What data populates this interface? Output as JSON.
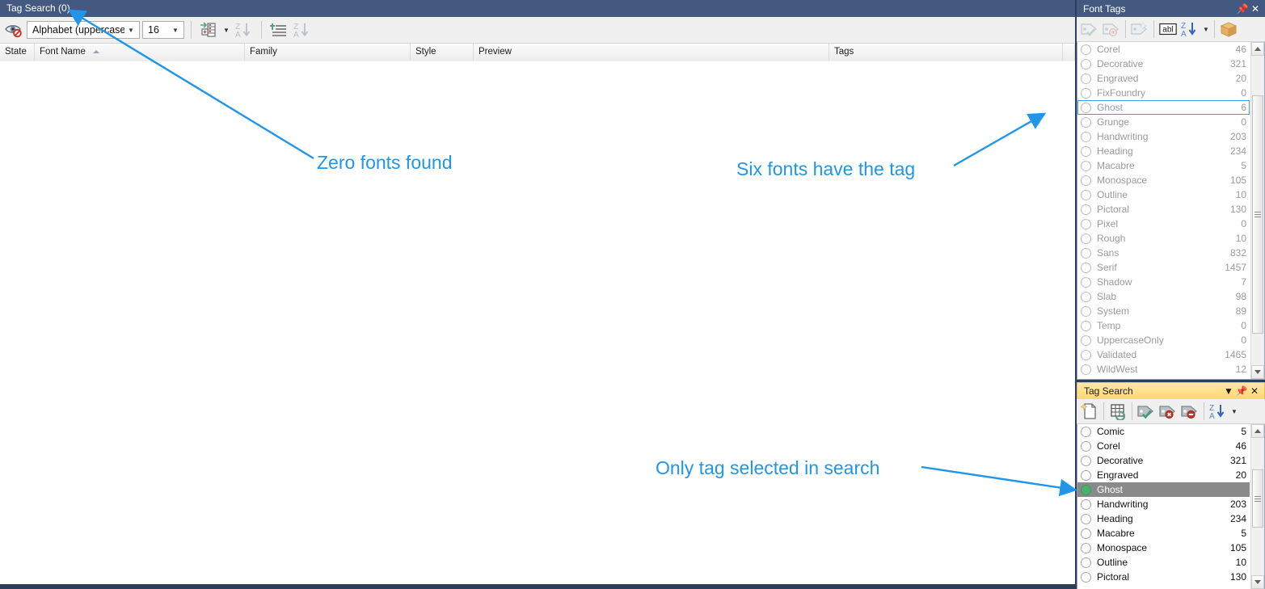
{
  "main_window": {
    "title": "Tag Search (0)",
    "toolbar": {
      "preview_icon": "eye-disabled-icon",
      "alphabet_combo": {
        "value": "Alphabet (uppercase)",
        "arrow": "chevron-down-icon"
      },
      "size_combo": {
        "value": "16",
        "arrow": "chevron-down-icon"
      },
      "group_button_icon": "add-to-collection-icon",
      "group_dropdown_icon": "chevron-down-icon",
      "sort_za_icon": "sort-za-descending-icon",
      "add_tag_icon": "add-tag-list-icon",
      "sort_za_icon_2": "sort-za-descending-icon"
    },
    "columns": [
      {
        "label": "State"
      },
      {
        "label": "Font Name",
        "sort": "ascending"
      },
      {
        "label": "Family"
      },
      {
        "label": "Style"
      },
      {
        "label": "Preview"
      },
      {
        "label": "Tags"
      }
    ],
    "rows": []
  },
  "font_tags_panel": {
    "title": "Font Tags",
    "pin_icon": "pin-icon",
    "close_icon": "close-icon",
    "toolbar": [
      {
        "name": "apply-tag-icon",
        "enabled": false
      },
      {
        "name": "remove-tag-icon",
        "enabled": false
      },
      {
        "name": "new-tag-icon",
        "enabled": false
      },
      {
        "name": "rename-tag-icon",
        "label": "abl",
        "enabled": true
      },
      {
        "name": "sort-az-icon",
        "enabled": true
      },
      {
        "name": "sort-dropdown-icon",
        "enabled": true
      },
      {
        "name": "package-box-icon",
        "enabled": true
      }
    ],
    "tags": [
      {
        "name": "Corel",
        "count": "46"
      },
      {
        "name": "Decorative",
        "count": "321"
      },
      {
        "name": "Engraved",
        "count": "20"
      },
      {
        "name": "FixFoundry",
        "count": "0"
      },
      {
        "name": "Ghost",
        "count": "6",
        "focused": true
      },
      {
        "name": "Grunge",
        "count": "0"
      },
      {
        "name": "Handwriting",
        "count": "203"
      },
      {
        "name": "Heading",
        "count": "234"
      },
      {
        "name": "Macabre",
        "count": "5"
      },
      {
        "name": "Monospace",
        "count": "105"
      },
      {
        "name": "Outline",
        "count": "10"
      },
      {
        "name": "Pictoral",
        "count": "130"
      },
      {
        "name": "Pixel",
        "count": "0"
      },
      {
        "name": "Rough",
        "count": "10"
      },
      {
        "name": "Sans",
        "count": "832"
      },
      {
        "name": "Serif",
        "count": "1457"
      },
      {
        "name": "Shadow",
        "count": "7"
      },
      {
        "name": "Slab",
        "count": "98"
      },
      {
        "name": "System",
        "count": "89"
      },
      {
        "name": "Temp",
        "count": "0"
      },
      {
        "name": "UppercaseOnly",
        "count": "0"
      },
      {
        "name": "Validated",
        "count": "1465"
      },
      {
        "name": "WildWest",
        "count": "12"
      }
    ]
  },
  "tag_search_panel": {
    "title": "Tag Search",
    "menu_icon": "chevron-down-icon",
    "pin_icon": "pin-icon",
    "close_icon": "close-icon",
    "toolbar": [
      {
        "name": "new-search-icon"
      },
      {
        "name": "refresh-grid-icon"
      },
      {
        "name": "include-tag-icon"
      },
      {
        "name": "exclude-tag-icon"
      },
      {
        "name": "block-tag-icon"
      },
      {
        "name": "sort-az-icon"
      },
      {
        "name": "sort-dropdown-icon"
      }
    ],
    "tags": [
      {
        "name": "Comic",
        "count": "5"
      },
      {
        "name": "Corel",
        "count": "46"
      },
      {
        "name": "Decorative",
        "count": "321"
      },
      {
        "name": "Engraved",
        "count": "20"
      },
      {
        "name": "Ghost",
        "count": "",
        "selected": true,
        "marked": true
      },
      {
        "name": "Handwriting",
        "count": "203"
      },
      {
        "name": "Heading",
        "count": "234"
      },
      {
        "name": "Macabre",
        "count": "5"
      },
      {
        "name": "Monospace",
        "count": "105"
      },
      {
        "name": "Outline",
        "count": "10"
      },
      {
        "name": "Pictoral",
        "count": "130"
      }
    ]
  },
  "annotations": {
    "color": "#2196e8",
    "zero_fonts": "Zero fonts found",
    "six_fonts": "Six fonts have the tag",
    "only_tag": "Only tag selected in search"
  }
}
